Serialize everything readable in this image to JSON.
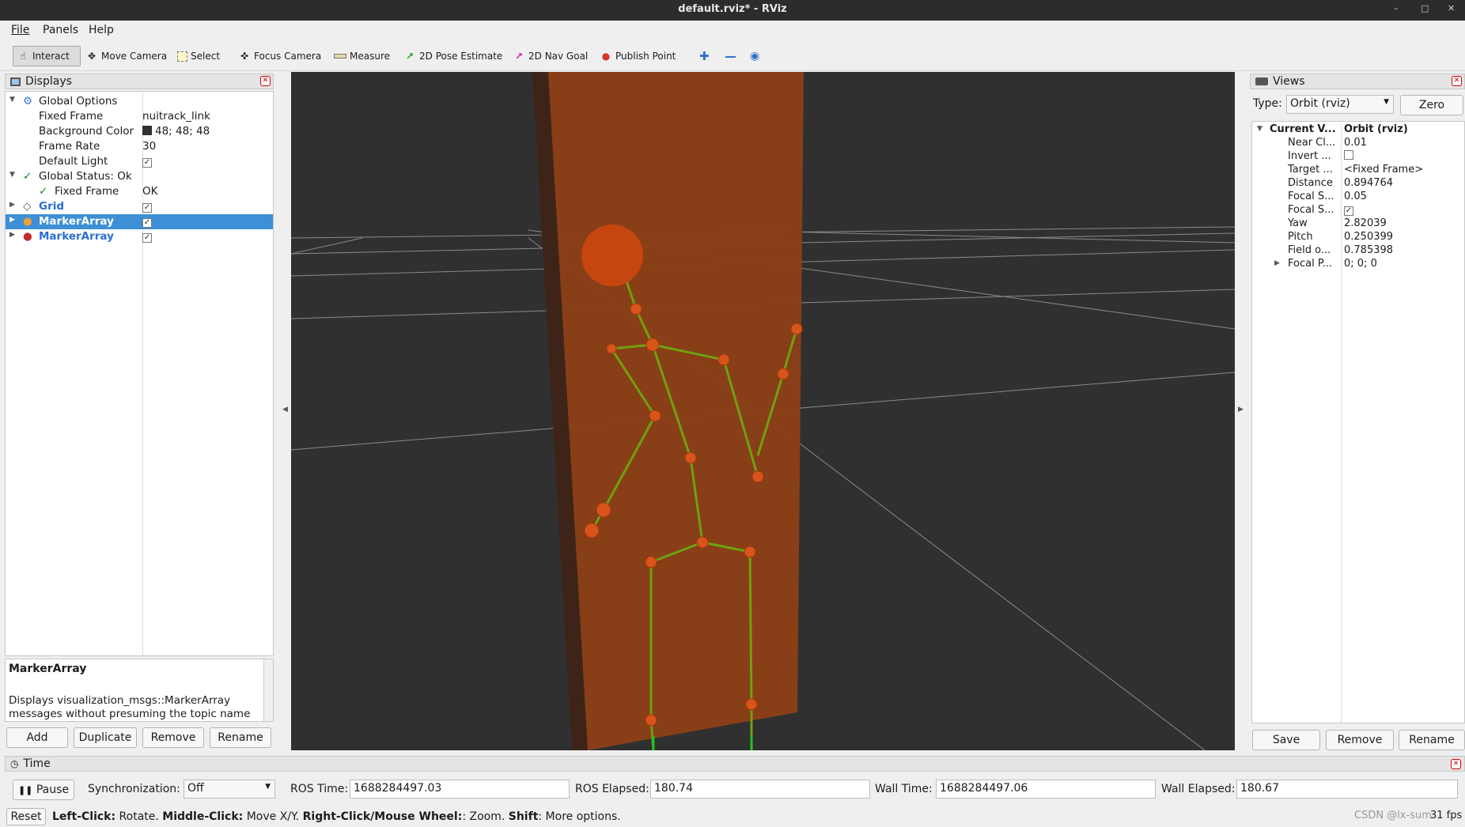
{
  "window": {
    "title": "default.rviz* - RViz"
  },
  "menu": {
    "file": "File",
    "panels": "Panels",
    "help": "Help"
  },
  "toolbar": {
    "interact": "Interact",
    "move_camera": "Move Camera",
    "select": "Select",
    "focus_camera": "Focus Camera",
    "measure": "Measure",
    "pose_estimate": "2D Pose Estimate",
    "nav_goal": "2D Nav Goal",
    "publish_point": "Publish Point"
  },
  "displays": {
    "title": "Displays",
    "global_options": "Global Options",
    "fixed_frame_label": "Fixed Frame",
    "fixed_frame_value": "nuitrack_link",
    "background_color_label": "Background Color",
    "background_color_value": "48; 48; 48",
    "frame_rate_label": "Frame Rate",
    "frame_rate_value": "30",
    "default_light_label": "Default Light",
    "global_status": "Global Status: Ok",
    "status_fixed_frame": "Fixed Frame",
    "status_fixed_frame_value": "OK",
    "grid": "Grid",
    "marker_array_1": "MarkerArray",
    "marker_array_2": "MarkerArray",
    "desc_title": "MarkerArray",
    "desc_line1": "Displays visualization_msgs::MarkerArray",
    "desc_line2": "messages without presuming the topic name",
    "btn_add": "Add",
    "btn_duplicate": "Duplicate",
    "btn_remove": "Remove",
    "btn_rename": "Rename"
  },
  "views": {
    "title": "Views",
    "type_label": "Type:",
    "type_value": "Orbit (rviz)",
    "zero": "Zero",
    "current_label": "Current V...",
    "current_value": "Orbit (rviz)",
    "rows": [
      {
        "name": "Near Cl...",
        "value": "0.01"
      },
      {
        "name": "Invert ...",
        "value": ""
      },
      {
        "name": "Target ...",
        "value": "<Fixed Frame>"
      },
      {
        "name": "Distance",
        "value": "0.894764"
      },
      {
        "name": "Focal S...",
        "value": "0.05"
      },
      {
        "name": "Focal S...",
        "value": ""
      },
      {
        "name": "Yaw",
        "value": "2.82039"
      },
      {
        "name": "Pitch",
        "value": "0.250399"
      },
      {
        "name": "Field o...",
        "value": "0.785398"
      },
      {
        "name": "Focal P...",
        "value": "0; 0; 0"
      }
    ],
    "btn_save": "Save",
    "btn_remove": "Remove",
    "btn_rename": "Rename"
  },
  "time": {
    "title": "Time",
    "pause": "Pause",
    "sync_label": "Synchronization:",
    "sync_value": "Off",
    "ros_time_label": "ROS Time:",
    "ros_time_value": "1688284497.03",
    "ros_elapsed_label": "ROS Elapsed:",
    "ros_elapsed_value": "180.74",
    "wall_time_label": "Wall Time:",
    "wall_time_value": "1688284497.06",
    "wall_elapsed_label": "Wall Elapsed:",
    "wall_elapsed_value": "180.67"
  },
  "status": {
    "reset": "Reset",
    "k1": "Left-Click:",
    "t1": " Rotate. ",
    "k2": "Middle-Click:",
    "t2": " Move X/Y. ",
    "k3": "Right-Click/Mouse Wheel:",
    "t3": ": Zoom. ",
    "k4": "Shift",
    "t4": ": More options.",
    "fps": "31 fps",
    "watermark": "CSDN @lx-sum"
  },
  "colors": {
    "background": "#303030",
    "plane": "#8b3f16",
    "skeleton": "#6fa010",
    "joint": "#d9541a",
    "selection": "#3d8fd6"
  }
}
